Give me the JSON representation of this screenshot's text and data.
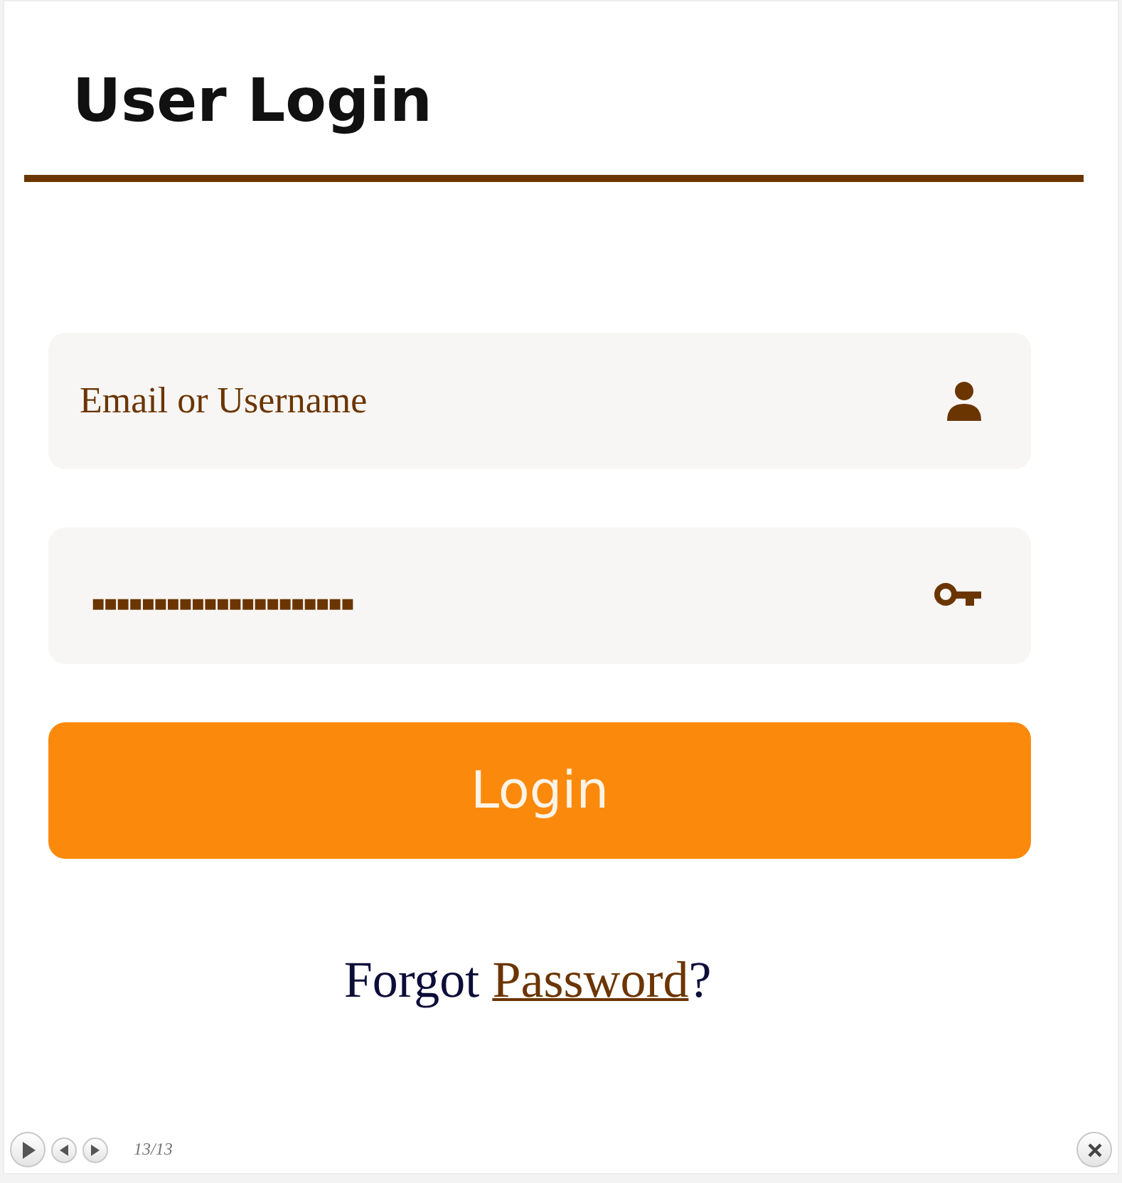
{
  "title": "User Login",
  "username_field": {
    "placeholder": "Email or Username"
  },
  "password_field": {
    "mask": "▪▪▪▪▪▪▪▪▪▪▪▪▪▪▪▪▪▪▪▪▪"
  },
  "login_button": "Login",
  "forgot": {
    "before": "Forgot",
    "link": "Password",
    "after": "?"
  },
  "player": {
    "counter": "13/13"
  }
}
